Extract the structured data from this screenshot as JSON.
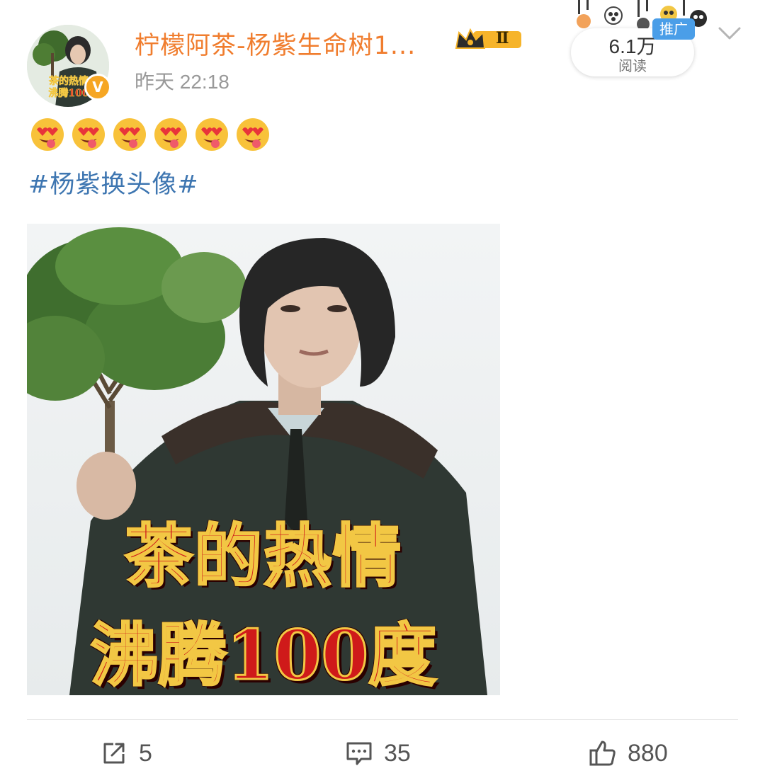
{
  "header": {
    "username": "柠檬阿茶-杨紫生命树1...",
    "vip_level": "Ⅱ",
    "timestamp": "昨天 22:18",
    "verified_glyph": "V",
    "avatar_text": [
      "茶的热情",
      "沸腾100"
    ],
    "read": {
      "count": "6.1万",
      "label": "阅读"
    },
    "promo_tag": "推广"
  },
  "post": {
    "emojis": [
      "heart-eyes-tongue-emoji",
      "heart-eyes-tongue-emoji",
      "heart-eyes-tongue-emoji",
      "heart-eyes-tongue-emoji",
      "heart-eyes-tongue-emoji",
      "heart-eyes-tongue-emoji"
    ],
    "hashtag": "#杨紫换头像#",
    "image_caption": {
      "line1": "茶的热情",
      "line2": "沸腾100度"
    }
  },
  "actions": {
    "share": {
      "icon": "share-icon",
      "count": "5"
    },
    "comment": {
      "icon": "comment-icon",
      "count": "35"
    },
    "like": {
      "icon": "thumbs-up-icon",
      "count": "880"
    }
  },
  "colors": {
    "username": "#f07d2e",
    "hashtag": "#3e76b1",
    "verified": "#f6a623",
    "promo": "#4a9ee8",
    "caption_red": "#cf1a1a",
    "caption_gold": "#f2c744"
  }
}
